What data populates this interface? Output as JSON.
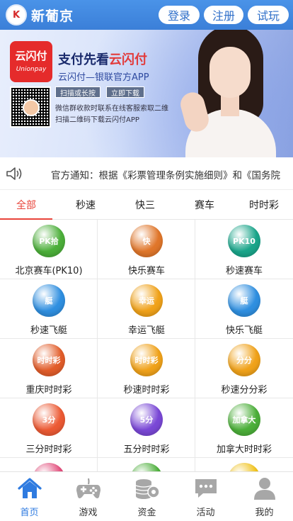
{
  "header": {
    "logo_mark": "K",
    "app_title": "新葡京",
    "login_label": "登录",
    "register_label": "注册",
    "trial_label": "试玩"
  },
  "banner": {
    "unionpay_cn": "云闪付",
    "unionpay_en": "Unionpay",
    "headline_prefix": "支付先看",
    "headline_highlight": "云闪付",
    "subline": "云闪付—银联官方APP",
    "pill_1": "扫描或长按",
    "pill_2": "立即下载",
    "small_line_1": "微信群收款时联系在线客服索取二维",
    "small_line_2": "扫描二维码下载云闪付APP",
    "slide_count": 2,
    "active_slide": 1
  },
  "notice": {
    "icon": "speaker-icon",
    "text": "官方通知：根据《彩票管理条例实施细则》和《国务院"
  },
  "tabs": [
    {
      "label": "全部",
      "active": true
    },
    {
      "label": "秒速",
      "active": false
    },
    {
      "label": "快三",
      "active": false
    },
    {
      "label": "赛车",
      "active": false
    },
    {
      "label": "时时彩",
      "active": false
    }
  ],
  "games": [
    {
      "name": "北京赛车(PK10)",
      "badge": "PK拾",
      "color": "#4caf3a"
    },
    {
      "name": "快乐赛车",
      "badge": "快",
      "color": "#e0762a"
    },
    {
      "name": "秒速赛车",
      "badge": "PK10",
      "color": "#1aa58a"
    },
    {
      "name": "秒速飞艇",
      "badge": "艇",
      "color": "#2f8fe0"
    },
    {
      "name": "幸运飞艇",
      "badge": "幸运",
      "color": "#f0a21a"
    },
    {
      "name": "快乐飞艇",
      "badge": "艇",
      "color": "#2f8fe0"
    },
    {
      "name": "重庆时时彩",
      "badge": "时时彩",
      "color": "#e25d2a"
    },
    {
      "name": "秒速时时彩",
      "badge": "时时彩",
      "color": "#f0a21a"
    },
    {
      "name": "秒速分分彩",
      "badge": "分分",
      "color": "#f0a21a"
    },
    {
      "name": "三分时时彩",
      "badge": "3分",
      "color": "#ec5a34"
    },
    {
      "name": "五分时时彩",
      "badge": "5分",
      "color": "#7a48d6"
    },
    {
      "name": "加拿大时时彩",
      "badge": "加拿大",
      "color": "#4caf3a"
    },
    {
      "name": "",
      "badge": "",
      "color": "#e24b7a"
    },
    {
      "name": "",
      "badge": "",
      "color": "#4caf3a"
    },
    {
      "name": "",
      "badge": "",
      "color": "#f0c21a"
    }
  ],
  "bottom_nav": [
    {
      "label": "首页",
      "icon": "home-icon",
      "active": true
    },
    {
      "label": "游戏",
      "icon": "gamepad-icon",
      "active": false
    },
    {
      "label": "资金",
      "icon": "coins-icon",
      "active": false
    },
    {
      "label": "活动",
      "icon": "chat-icon",
      "active": false
    },
    {
      "label": "我的",
      "icon": "user-icon",
      "active": false
    }
  ],
  "colors": {
    "header_blue": "#3b7fd8",
    "accent_red": "#e8443a",
    "nav_active": "#2f7be0"
  }
}
